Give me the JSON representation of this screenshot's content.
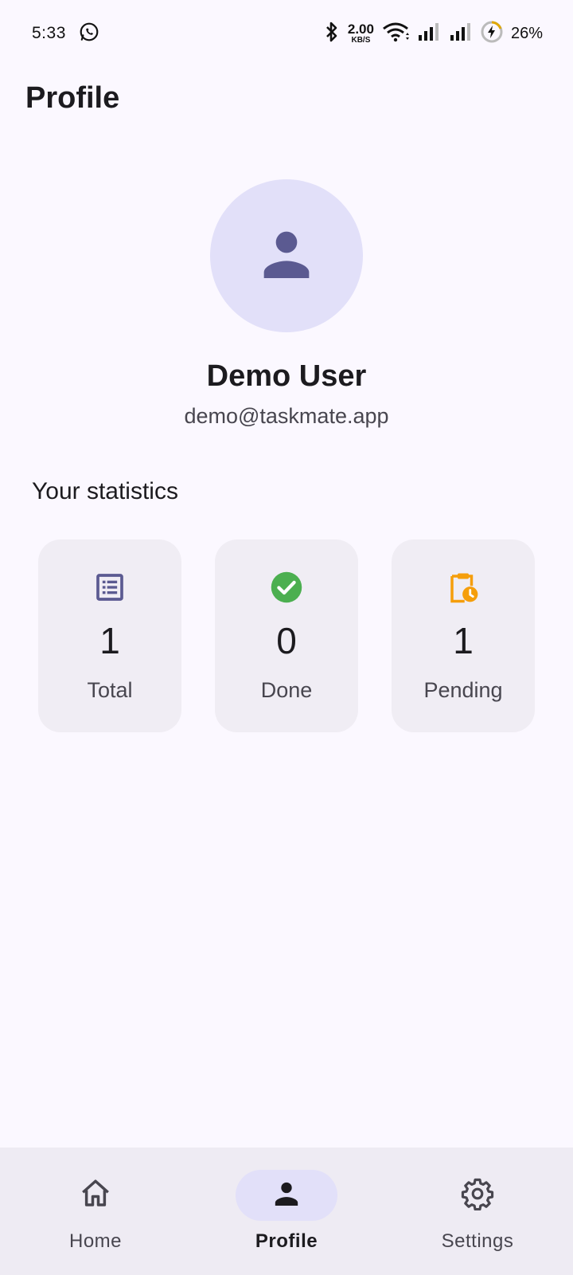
{
  "status_bar": {
    "time": "5:33",
    "net_speed_value": "2.00",
    "net_speed_unit": "KB/S",
    "battery_percent": "26%",
    "icons": [
      "whatsapp-icon",
      "bluetooth-icon",
      "wifi-icon",
      "signal-icon",
      "signal-icon",
      "battery-charging-icon"
    ]
  },
  "header": {
    "title": "Profile"
  },
  "profile": {
    "avatar_icon": "person-icon",
    "name": "Demo User",
    "email": "demo@taskmate.app"
  },
  "statistics": {
    "title": "Your statistics",
    "cards": [
      {
        "icon": "list-icon",
        "icon_color": "#5b5a91",
        "value": "1",
        "label": "Total"
      },
      {
        "icon": "check-circle-icon",
        "icon_color": "#4caf50",
        "value": "0",
        "label": "Done"
      },
      {
        "icon": "clipboard-clock-icon",
        "icon_color": "#f59e0b",
        "value": "1",
        "label": "Pending"
      }
    ]
  },
  "bottom_nav": {
    "items": [
      {
        "icon": "home-icon",
        "label": "Home",
        "active": false
      },
      {
        "icon": "person-icon",
        "label": "Profile",
        "active": true
      },
      {
        "icon": "gear-icon",
        "label": "Settings",
        "active": false
      }
    ]
  },
  "colors": {
    "background": "#fbf8ff",
    "accent_container": "#e2e0f9",
    "accent": "#5b5a91",
    "card_background": "#f0edf4"
  }
}
